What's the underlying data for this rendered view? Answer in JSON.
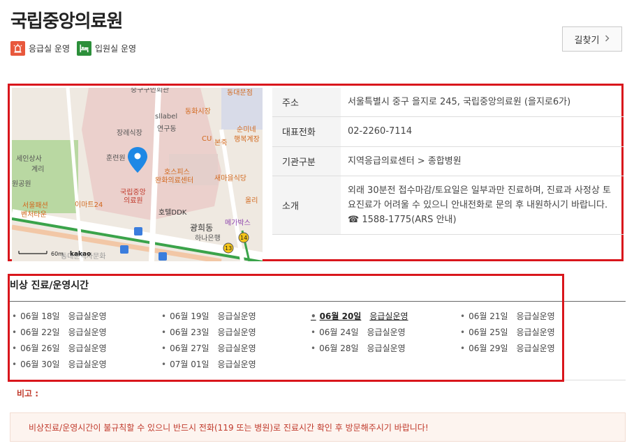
{
  "hospital": {
    "name": "국립중앙의료원"
  },
  "badges": [
    {
      "label": "응급실 운영",
      "icon": "ambulance-siren-icon",
      "color": "#e8583c"
    },
    {
      "label": "입원실 운영",
      "icon": "bed-icon",
      "color": "#2c8f3a"
    }
  ],
  "route_button": {
    "label": "길찾기",
    "icon": "chevron-right-icon"
  },
  "map": {
    "labels": {
      "top_partial": "중구구민회관",
      "dongdae": "동대문점",
      "donghwa": "동화시장",
      "sllabel": "sllabel",
      "janggye": "장례식장",
      "yeongu": "연구동",
      "cu": "CU",
      "sunmine": "순미네",
      "haengbok": "행복계장",
      "bonjuk": "본죽",
      "training": "훈련원",
      "seinsang": "세인상사",
      "gyeri": "계리",
      "hospice": "호스피스",
      "hospice2": "완화의료센터",
      "saema": "새마을식당",
      "park": "원공원",
      "nmc_map1": "국립중앙",
      "nmc_map2": "의료원",
      "emart": "이마트24",
      "seoul1": "서울패션",
      "seoul2": "벤처타운",
      "olli": "올리",
      "hotel": "호텔DDK",
      "gwanghui": "광희동",
      "mega": "메가박스",
      "hana": "하나은행",
      "scale": "60m",
      "kakao": "kakao",
      "bottom_partial": "동대문역사문화",
      "route13": "13",
      "route14": "14"
    }
  },
  "info": [
    {
      "label": "주소",
      "value": "서울특별시 중구 을지로 245, 국립중앙의료원 (을지로6가)"
    },
    {
      "label": "대표전화",
      "value": "02-2260-7114"
    },
    {
      "label": "기관구분",
      "value": "지역응급의료센터 > 종합병원"
    },
    {
      "label": "소개",
      "value": "외래 30분전 접수마감/토요일은 일부과만 진료하며, 진료과 사정상 토요진료가 어려울 수 있으니 안내전화로 문의 후 내원하시기 바랍니다. ☎ 1588-1775(ARS 안내)"
    }
  ],
  "schedule": {
    "title": "비상 진료/운영시간",
    "items": [
      {
        "date": "06월 18일",
        "status": "응급실운영"
      },
      {
        "date": "06월 19일",
        "status": "응급실운영"
      },
      {
        "date": "06월 20일",
        "status": "응급실운영",
        "today": true
      },
      {
        "date": "06월 21일",
        "status": "응급실운영"
      },
      {
        "date": "06월 22일",
        "status": "응급실운영"
      },
      {
        "date": "06월 23일",
        "status": "응급실운영"
      },
      {
        "date": "06월 24일",
        "status": "응급실운영"
      },
      {
        "date": "06월 25일",
        "status": "응급실운영"
      },
      {
        "date": "06월 26일",
        "status": "응급실운영"
      },
      {
        "date": "06월 27일",
        "status": "응급실운영"
      },
      {
        "date": "06월 28일",
        "status": "응급실운영"
      },
      {
        "date": "06월 29일",
        "status": "응급실운영"
      },
      {
        "date": "06월 30일",
        "status": "응급실운영"
      },
      {
        "date": "07월 01일",
        "status": "응급실운영"
      }
    ]
  },
  "remark": {
    "label": "비고 :"
  },
  "notice": {
    "text": "비상진료/운영시간이 불규칙할 수 있으니 반드시 전화(119 또는 병원)로 진료시간 확인 후 방문해주시기 바랍니다!"
  }
}
